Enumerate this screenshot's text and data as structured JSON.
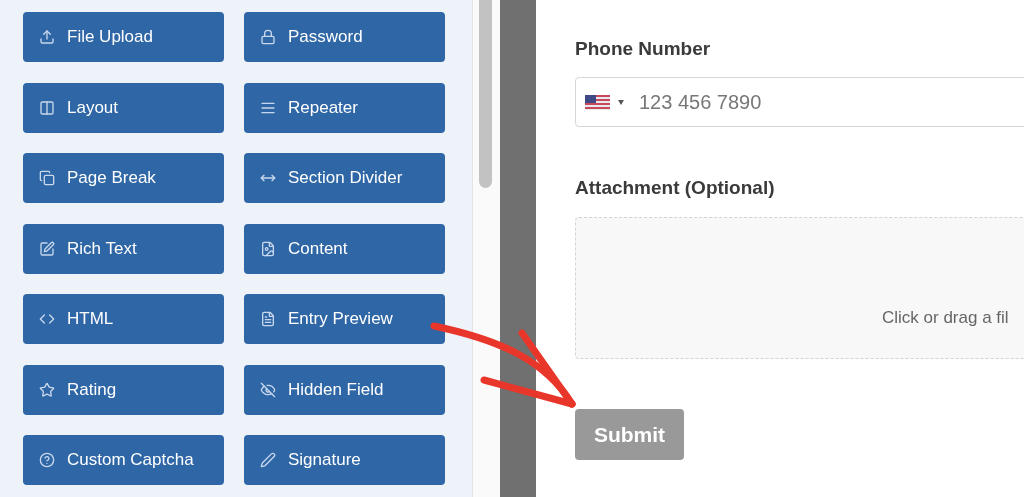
{
  "fields_panel": {
    "buttons": [
      {
        "label": "File Upload"
      },
      {
        "label": "Password"
      },
      {
        "label": "Layout"
      },
      {
        "label": "Repeater"
      },
      {
        "label": "Page Break"
      },
      {
        "label": "Section Divider"
      },
      {
        "label": "Rich Text"
      },
      {
        "label": "Content"
      },
      {
        "label": "HTML"
      },
      {
        "label": "Entry Preview"
      },
      {
        "label": "Rating"
      },
      {
        "label": "Hidden Field"
      },
      {
        "label": "Custom Captcha"
      },
      {
        "label": "Signature"
      }
    ]
  },
  "form": {
    "phone": {
      "label": "Phone Number",
      "placeholder": "123 456 7890"
    },
    "attachment": {
      "label": "Attachment (Optional)",
      "hint": "Click or drag a fil"
    },
    "submit": "Submit"
  }
}
